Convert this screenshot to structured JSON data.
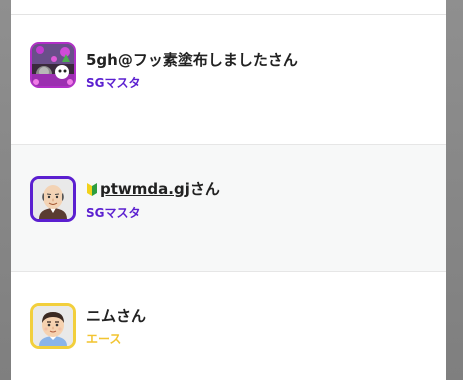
{
  "members": [
    {
      "name_prefix": "5gh@フッ素塗布しました",
      "name_suffix": "さん",
      "rank": "SGマスタ",
      "rank_color": "#5b1fd0",
      "avatar_border": "#b12fc7",
      "avatar_icon": "game-character-avatar"
    },
    {
      "badge_icon": "beginner-leaf-icon",
      "handle": "ptwmda.gj",
      "name_suffix": "さん",
      "rank": "SGマスタ",
      "rank_color": "#5b1fd0",
      "avatar_border": "#5b1fd0",
      "avatar_icon": "bald-man-avatar"
    },
    {
      "name_prefix": "ニム",
      "name_suffix": "さん",
      "rank": "エース",
      "rank_color": "#f2c431",
      "avatar_border": "#f2cf3c",
      "avatar_icon": "boy-avatar"
    }
  ]
}
